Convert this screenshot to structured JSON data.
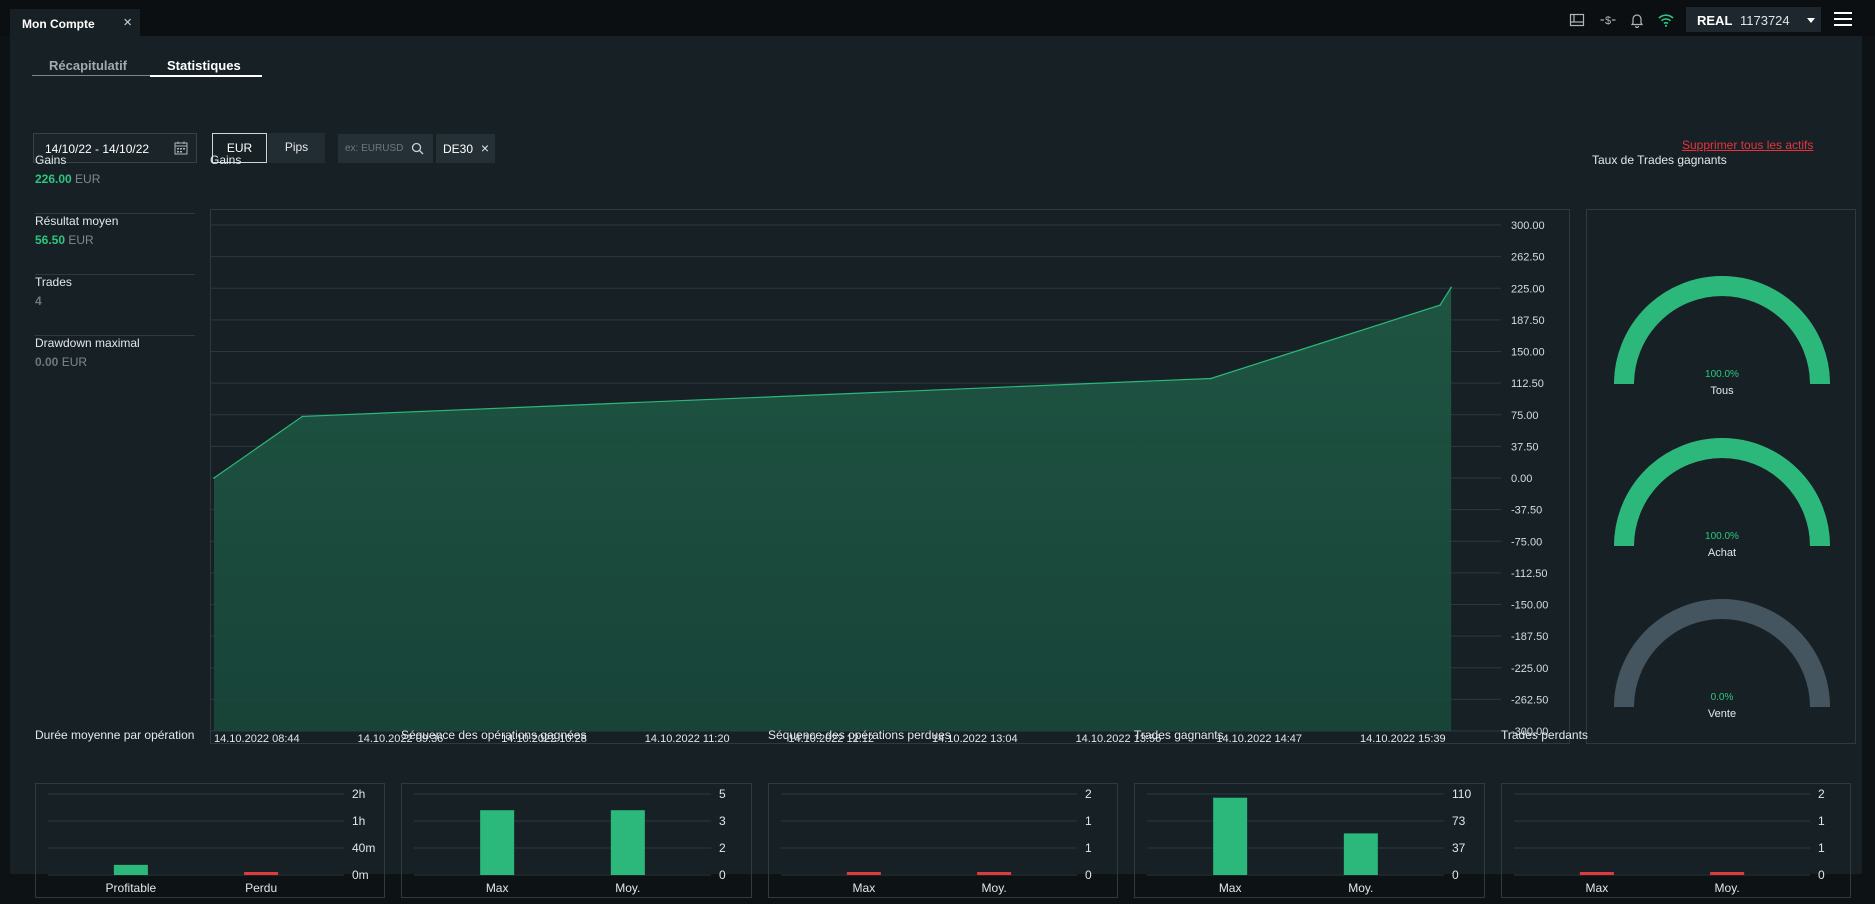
{
  "window": {
    "title": "Mon Compte",
    "close": "×"
  },
  "account": {
    "type": "REAL",
    "number": "1173724"
  },
  "tabs": [
    {
      "label": "Récapitulatif"
    },
    {
      "label": "Statistiques"
    }
  ],
  "filters": {
    "date_range": "14/10/22 - 14/10/22",
    "currency": "EUR",
    "pips": "Pips",
    "search_placeholder": "ex: EURUSD",
    "chip": "DE30",
    "chip_remove": "×",
    "delete_all": "Supprimer tous les actifs"
  },
  "stats": [
    {
      "label": "Gains",
      "value": "226.00",
      "unit": "EUR"
    },
    {
      "label": "Résultat moyen",
      "value": "56.50",
      "unit": "EUR"
    },
    {
      "label": "Trades",
      "value": "4",
      "unit": ""
    },
    {
      "label": "Drawdown maximal",
      "value": "0.00",
      "unit": "EUR"
    }
  ],
  "colors": {
    "accent": "#2cb87b",
    "loss": "#e03a3e",
    "gauge_empty": "#45555f",
    "panel": "#172125",
    "delete_link": "#e5343e"
  },
  "chart_data": [
    {
      "type": "area",
      "title": "Gains",
      "x": [
        "14.10.2022 08:44",
        "14.10.2022 09:16",
        "14.10.2022 14:45",
        "14.10.2022 16:08",
        "14.10.2022 16:12"
      ],
      "values": [
        0,
        73,
        118,
        205,
        226
      ],
      "xticks": [
        "14.10.2022 08:44",
        "14.10.2022 09:36",
        "14.10.2022 10:28",
        "14.10.2022 11:20",
        "14.10.2022 12:12",
        "14.10.2022 13:04",
        "14.10.2022 13:56",
        "14.10.2022 14:47",
        "14.10.2022 15:39"
      ],
      "yticks": [
        "300.00",
        "262.50",
        "225.00",
        "187.50",
        "150.00",
        "112.50",
        "75.00",
        "37.50",
        "0.00",
        "-37.50",
        "-75.00",
        "-112.50",
        "-150.00",
        "-187.50",
        "-225.00",
        "-262.50",
        "-300.00"
      ],
      "ylim": [
        -300,
        300
      ],
      "grid": true
    },
    {
      "type": "gauge",
      "title": "Taux de Trades gagnants",
      "items": [
        {
          "label": "Tous",
          "value": 100,
          "text": "100.0%"
        },
        {
          "label": "Achat",
          "value": 100,
          "text": "100.0%"
        },
        {
          "label": "Vente",
          "value": 0,
          "text": "0.0%"
        }
      ]
    },
    {
      "type": "bar",
      "title": "Durée moyenne par opération",
      "categories": [
        "Profitable",
        "Perdu"
      ],
      "values": [
        15,
        0
      ],
      "yticks": [
        "2h",
        "1h",
        "40m",
        "0m"
      ],
      "bar_colors": [
        "#2cb87b",
        "#e03a3e"
      ]
    },
    {
      "type": "bar",
      "title": "Séquence des opérations gagnées",
      "categories": [
        "Max",
        "Moy."
      ],
      "values": [
        4,
        4
      ],
      "yticks": [
        "5",
        "3",
        "2",
        "0"
      ],
      "bar_colors": [
        "#2cb87b",
        "#2cb87b"
      ]
    },
    {
      "type": "bar",
      "title": "Séquence des opérations perdues",
      "categories": [
        "Max",
        "Moy."
      ],
      "values": [
        0,
        0
      ],
      "yticks": [
        "2",
        "1",
        "1",
        "0"
      ],
      "bar_colors": [
        "#e03a3e",
        "#e03a3e"
      ]
    },
    {
      "type": "bar",
      "title": "Trades gagnants",
      "categories": [
        "Max",
        "Moy."
      ],
      "values": [
        105,
        56.5
      ],
      "yticks": [
        "110",
        "73",
        "37",
        "0"
      ],
      "bar_colors": [
        "#2cb87b",
        "#2cb87b"
      ]
    },
    {
      "type": "bar",
      "title": "Trades perdants",
      "categories": [
        "Max",
        "Moy."
      ],
      "values": [
        0,
        0
      ],
      "yticks": [
        "2",
        "1",
        "1",
        "0"
      ],
      "bar_colors": [
        "#e03a3e",
        "#e03a3e"
      ]
    }
  ]
}
